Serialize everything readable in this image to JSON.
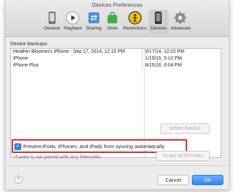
{
  "window": {
    "title": "Devices Preferences"
  },
  "toolbar": {
    "items": [
      {
        "label": "General",
        "icon": "phone-general-icon"
      },
      {
        "label": "Playback",
        "icon": "play-icon"
      },
      {
        "label": "Sharing",
        "icon": "sharing-icon"
      },
      {
        "label": "Store",
        "icon": "store-bag-icon"
      },
      {
        "label": "Restrictions",
        "icon": "restrictions-icon"
      },
      {
        "label": "Devices",
        "icon": "devices-icon",
        "active": true
      },
      {
        "label": "Advanced",
        "icon": "gear-icon"
      }
    ]
  },
  "backups": {
    "label": "Device backups:",
    "rows": [
      {
        "name": "Heather Bloomer's iPhone - Sep 17, 2014, 12:15 PM",
        "date": "9/17/14, 12:02 PM"
      },
      {
        "name": "iPhone",
        "date": "1/19/15, 5:10 PM"
      },
      {
        "name": "iPhone Plus",
        "date": "8/15/16, 6:04 PM"
      }
    ]
  },
  "buttons": {
    "delete_backup": "Delete Backup",
    "forget_remotes": "Forget All Remotes",
    "cancel": "Cancel",
    "ok": "OK",
    "help": "?"
  },
  "prevent": {
    "label": "Prevent iPods, iPhones, and iPads from syncing automatically",
    "checked": true
  },
  "remotes": {
    "status": "iTunes is not paired with any Remotes"
  },
  "colors": {
    "accent": "#2f86f7",
    "highlight": "#d3262b"
  }
}
